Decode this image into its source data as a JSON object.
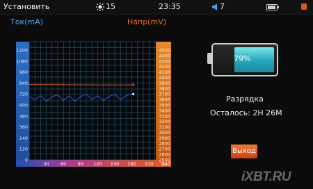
{
  "statusbar": {
    "set_label": "Установить",
    "brightness_icon": "sun-icon",
    "brightness": "15",
    "time": "23:35",
    "volume_icon": "speaker-icon",
    "volume": "7",
    "battery_icon": "battery-icon",
    "menu_icon": "menu-icon"
  },
  "chart_labels": {
    "current": "Ток(mA)",
    "voltage": "Напр(mV)"
  },
  "chart_data": {
    "type": "line",
    "left_axis_ticks": [
      "1200",
      "1080",
      "960",
      "840",
      "720",
      "600",
      "480",
      "360",
      "240",
      "120",
      "0"
    ],
    "right_axis_ticks": [
      "4500",
      "4400",
      "4300",
      "4200",
      "4100",
      "4000",
      "3900",
      "3800",
      "3700",
      "3600",
      "3500",
      "3400",
      "3300",
      "3200",
      "3100",
      "3000",
      "2900",
      "2800",
      "2700",
      "2600",
      "2500"
    ],
    "x_ticks": [
      "30",
      "60",
      "90",
      "120",
      "150",
      "180",
      "210",
      "240"
    ],
    "x_unit": "(s)",
    "series": [
      {
        "color": "#e0602a",
        "axis": "right",
        "x": [
          0,
          30,
          60,
          90,
          120,
          150,
          180
        ],
        "y": [
          3870,
          3870,
          3868,
          3866,
          3865,
          3864,
          3865
        ]
      },
      {
        "color": "#3a56e0",
        "axis": "left",
        "x": [
          0,
          10,
          20,
          30,
          40,
          50,
          60,
          70,
          80,
          90,
          100,
          110,
          120,
          130,
          140,
          150,
          160,
          170,
          180
        ],
        "y": [
          690,
          660,
          700,
          640,
          690,
          710,
          650,
          700,
          640,
          690,
          720,
          660,
          700,
          650,
          690,
          720,
          660,
          700,
          720
        ]
      }
    ],
    "colors": {
      "grid": "#2f6f86",
      "left_axis": "#3b82c9",
      "right_axis": "#e2842d"
    }
  },
  "battery": {
    "percent": "79%",
    "level": 0.79
  },
  "status": {
    "state": "Разрядка",
    "remaining": "Осталось: 2H 26M"
  },
  "exit_label": "Выход",
  "watermark": "iXBT.RU"
}
